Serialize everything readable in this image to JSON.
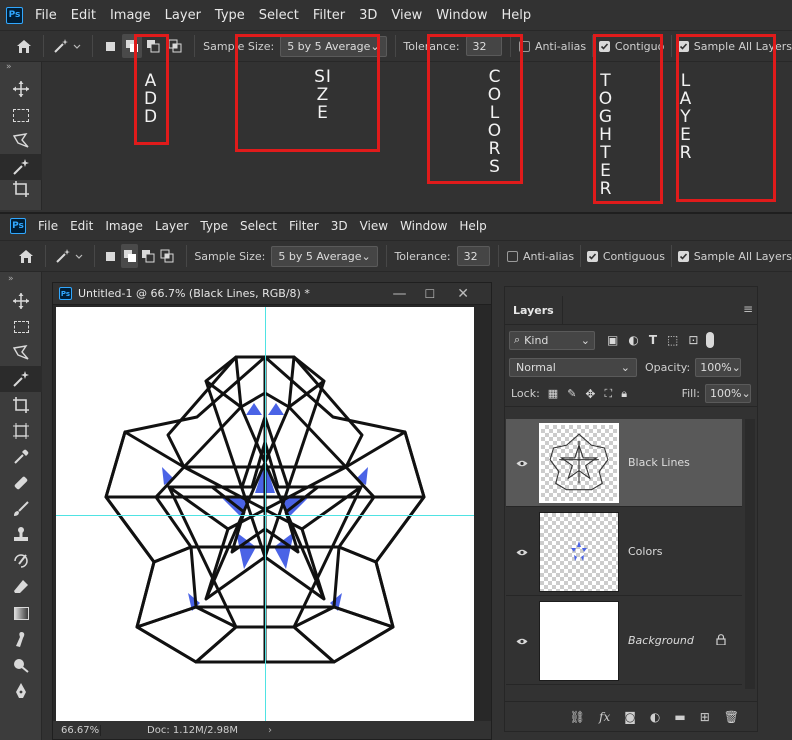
{
  "app": {
    "logo": "Ps"
  },
  "menu": [
    "File",
    "Edit",
    "Image",
    "Layer",
    "Type",
    "Select",
    "Filter",
    "3D",
    "View",
    "Window",
    "Help"
  ],
  "options": {
    "sample_size_label": "Sample Size:",
    "sample_size_top": "5 by 5 Average",
    "sample_size": "5 by 5 Average",
    "tolerance_label": "Tolerance:",
    "tolerance": "32",
    "anti_alias": "Anti-alias",
    "contiguous_top": "Contiguous",
    "contiguous": "Contiguous",
    "sample_all_layers": "Sample All Layers",
    "anti_alias_checked": false,
    "contiguous_checked": true,
    "sample_all_layers_checked": true
  },
  "annotations": [
    {
      "id": "add",
      "text": "ADD"
    },
    {
      "id": "size",
      "text": "SIZE"
    },
    {
      "id": "colors",
      "text": "COLORS"
    },
    {
      "id": "together",
      "text": "TOGHTER"
    },
    {
      "id": "layer",
      "text": "LAYER"
    }
  ],
  "document": {
    "tab_title": "Untitled-1 @ 66.7% (Black Lines, RGB/8) *",
    "zoom": "66.67%",
    "doc_info": "Doc: 1.12M/2.98M"
  },
  "layers_panel": {
    "title": "Layers",
    "filter_kind": "Kind",
    "blend_mode": "Normal",
    "opacity_label": "Opacity:",
    "opacity": "100%",
    "lock_label": "Lock:",
    "fill_label": "Fill:",
    "fill": "100%",
    "layers": [
      {
        "name": "Black Lines",
        "selected": true
      },
      {
        "name": "Colors",
        "selected": false
      },
      {
        "name": "Background",
        "selected": false,
        "locked": true
      }
    ]
  },
  "colors": {
    "annotation_red": "#e01b1b",
    "fill_blue": "#4a63e6",
    "guide": "#4fe3e3"
  }
}
